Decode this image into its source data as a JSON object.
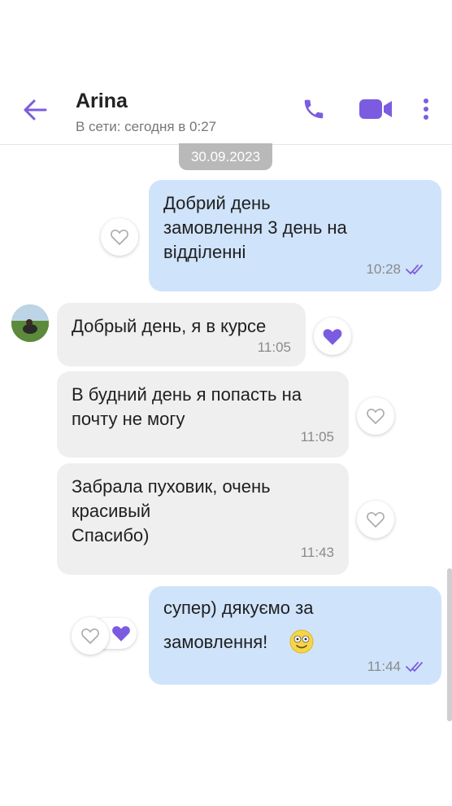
{
  "header": {
    "contact_name": "Arina",
    "status": "В сети: сегодня в 0:27"
  },
  "date_separator": "30.09.2023",
  "messages": [
    {
      "direction": "outgoing",
      "text": "Добрий день\nзамовлення 3 день на\nвідділенні",
      "time": "10:28",
      "read": true,
      "liked": false
    },
    {
      "direction": "incoming",
      "text": "Добрый день, я в курсе",
      "time": "11:05",
      "liked": true
    },
    {
      "direction": "incoming",
      "text": "В будний день я попасть на\nпочту не могу",
      "time": "11:05",
      "liked": false
    },
    {
      "direction": "incoming",
      "text": "Забрала пуховик, очень\nкрасивый\nСпасибо)",
      "time": "11:43",
      "liked": false
    },
    {
      "direction": "outgoing",
      "text": "супер) дякуємо за\nзамовлення!",
      "time": "11:44",
      "read": true,
      "liked": true
    }
  ],
  "colors": {
    "accent": "#7b5ce0",
    "outgoing_bubble": "#cfe3fb",
    "incoming_bubble": "#efefef"
  }
}
